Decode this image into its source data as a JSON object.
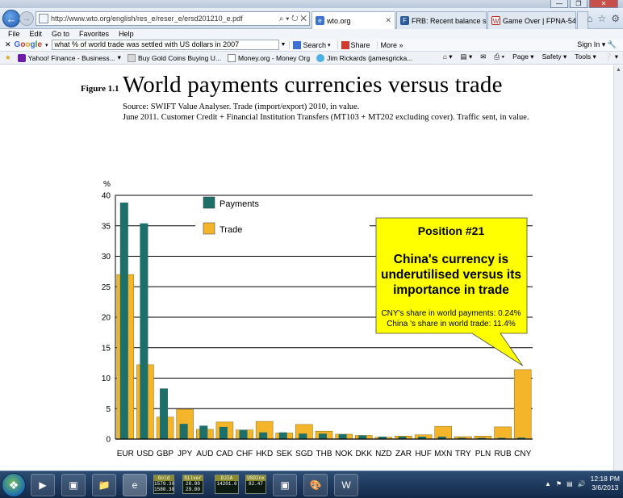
{
  "browser": {
    "url": "http://www.wto.org/english/res_e/reser_e/ersd201210_e.pdf",
    "address_actions": "⌕ ▾ ↻ ✕",
    "tabs": [
      {
        "label": "wto.org",
        "icon": "pdf-icon",
        "active": true
      },
      {
        "label": "FRB: Recent balance sheet ...",
        "icon": "frb-icon",
        "active": false
      },
      {
        "label": "Game Over | FPNA-5452116",
        "icon": "w-icon",
        "active": false
      }
    ],
    "menu": [
      "File",
      "Edit",
      "Go to",
      "Favorites",
      "Help"
    ],
    "google_bar": {
      "query": "what % of world trade was settled with US dollars in 2007",
      "search_label": "Search",
      "share_label": "Share",
      "more_label": "More »",
      "sign_in": "Sign In"
    },
    "favorites": [
      {
        "label": "Yahoo! Finance - Business...",
        "icon": "yahoo-icon"
      },
      {
        "label": "Buy Gold Coins Buying U...",
        "icon": "gold-coins-icon"
      },
      {
        "label": "Money.org - Money Org",
        "icon": "money-org-icon"
      },
      {
        "label": "Jim Rickards (jamesgricka...",
        "icon": "twitter-icon"
      }
    ],
    "command_bar": [
      "Page ▾",
      "Safety ▾",
      "Tools ▾"
    ]
  },
  "document": {
    "figure_label": "Figure 1.1",
    "title": "World payments currencies versus trade",
    "source_line1": "Source: SWIFT Value Analyser. Trade (import/export) 2010, in value.",
    "source_line2": "June 2011. Customer Credit + Financial Institution Transfers (MT103 + MT202 excluding cover). Traffic sent, in value."
  },
  "chart_data": {
    "type": "bar",
    "ylabel": "%",
    "ylim": [
      0,
      40
    ],
    "yticks": [
      0,
      5,
      10,
      15,
      20,
      25,
      30,
      35,
      40
    ],
    "categories": [
      "EUR",
      "USD",
      "GBP",
      "JPY",
      "AUD",
      "CAD",
      "CHF",
      "HKD",
      "SEK",
      "SGD",
      "THB",
      "NOK",
      "DKK",
      "NZD",
      "ZAR",
      "HUF",
      "MXN",
      "TRY",
      "PLN",
      "RUB",
      "CNY"
    ],
    "series": [
      {
        "name": "Payments",
        "color": "#1d6f6a",
        "values": [
          38.8,
          35.4,
          8.3,
          2.5,
          2.2,
          2.0,
          1.5,
          1.1,
          1.1,
          0.9,
          0.9,
          0.8,
          0.6,
          0.4,
          0.4,
          0.4,
          0.4,
          0.2,
          0.2,
          0.2,
          0.24
        ]
      },
      {
        "name": "Trade",
        "color": "#f4b52b",
        "values": [
          27.0,
          12.2,
          3.6,
          4.9,
          1.6,
          2.8,
          1.5,
          2.9,
          1.0,
          2.4,
          1.3,
          0.8,
          0.6,
          0.3,
          0.5,
          0.7,
          2.1,
          0.4,
          0.5,
          2.0,
          11.4
        ]
      }
    ],
    "grid": true,
    "legend": "top-left",
    "callout": {
      "heading": "Position #21",
      "body": "China's currency is underutilised versus its importance in trade",
      "note1": "CNY's share in world payments: 0.24%",
      "note2": "China 's share in world trade: 11.4%",
      "background": "#ffff00",
      "points_to": "CNY"
    }
  },
  "taskbar": {
    "gadgets": [
      {
        "label": "Gold",
        "line1": "1579.30",
        "line2": "1580.30"
      },
      {
        "label": "Silver",
        "line1": "28.90",
        "line2": "29.00"
      },
      {
        "label": "DJIA",
        "line1": "14201.6",
        "line2": ""
      },
      {
        "label": "USDInx",
        "line1": "82.47",
        "line2": ""
      }
    ],
    "time": "12:18 PM",
    "date": "3/6/2013"
  }
}
